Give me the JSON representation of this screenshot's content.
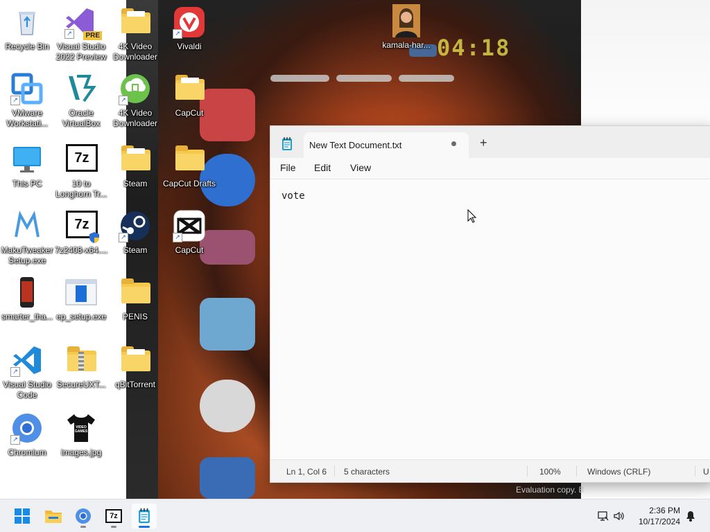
{
  "desktop": {
    "icons": [
      {
        "label": "Recycle Bin"
      },
      {
        "label": "Visual Studio 2022 Preview",
        "badge": "PRE"
      },
      {
        "label": "4K Video Downloader"
      },
      {
        "label": "Vivaldi"
      },
      {
        "label": "kamala-har..."
      },
      {
        "label": "VMware Workstati..."
      },
      {
        "label": "Oracle VirtualBox"
      },
      {
        "label": "4K Video Downloader"
      },
      {
        "label": "CapCut"
      },
      {
        "label": "This PC"
      },
      {
        "label": "10 to Longhorn Tr...",
        "glyph": "7z"
      },
      {
        "label": "Steam"
      },
      {
        "label": "CapCut Drafts"
      },
      {
        "label": "MakuTweaker Setup.exe"
      },
      {
        "label": "7z2408-x64....",
        "glyph": "7z"
      },
      {
        "label": "Steam"
      },
      {
        "label": "CapCut"
      },
      {
        "label": "smarter_tha..."
      },
      {
        "label": "ep_setup.exe"
      },
      {
        "label": "PENIS"
      },
      {
        "label": "Visual Studio Code"
      },
      {
        "label": "SecureUXT..."
      },
      {
        "label": "qBitTorrent"
      },
      {
        "label": "Chromium"
      },
      {
        "label": "images.jpg",
        "glyph": "VIDEO GAMES"
      }
    ]
  },
  "wallpaper": {
    "clock_text": "04:18",
    "watermark": "Evaluation copy. B"
  },
  "notepad": {
    "tab_title": "New Text Document.txt",
    "new_tab_symbol": "+",
    "menu": {
      "file": "File",
      "edit": "Edit",
      "view": "View"
    },
    "content": "vote",
    "status": {
      "position": "Ln 1, Col 6",
      "characters": "5 characters",
      "zoom": "100%",
      "line_ending": "Windows (CRLF)",
      "encoding_partial": "U"
    }
  },
  "taskbar": {
    "time": "2:36 PM",
    "date": "10/17/2024",
    "start_glyph": "⊞",
    "apps": [
      {
        "name": "start-button"
      },
      {
        "name": "file-explorer"
      },
      {
        "name": "chromium"
      },
      {
        "name": "7-zip",
        "glyph": "7z"
      },
      {
        "name": "notepad",
        "active": true
      }
    ]
  },
  "colors": {
    "accent": "#1a73e8",
    "taskbar_bg": "#eef0f4",
    "folder": "#f6c84c"
  }
}
